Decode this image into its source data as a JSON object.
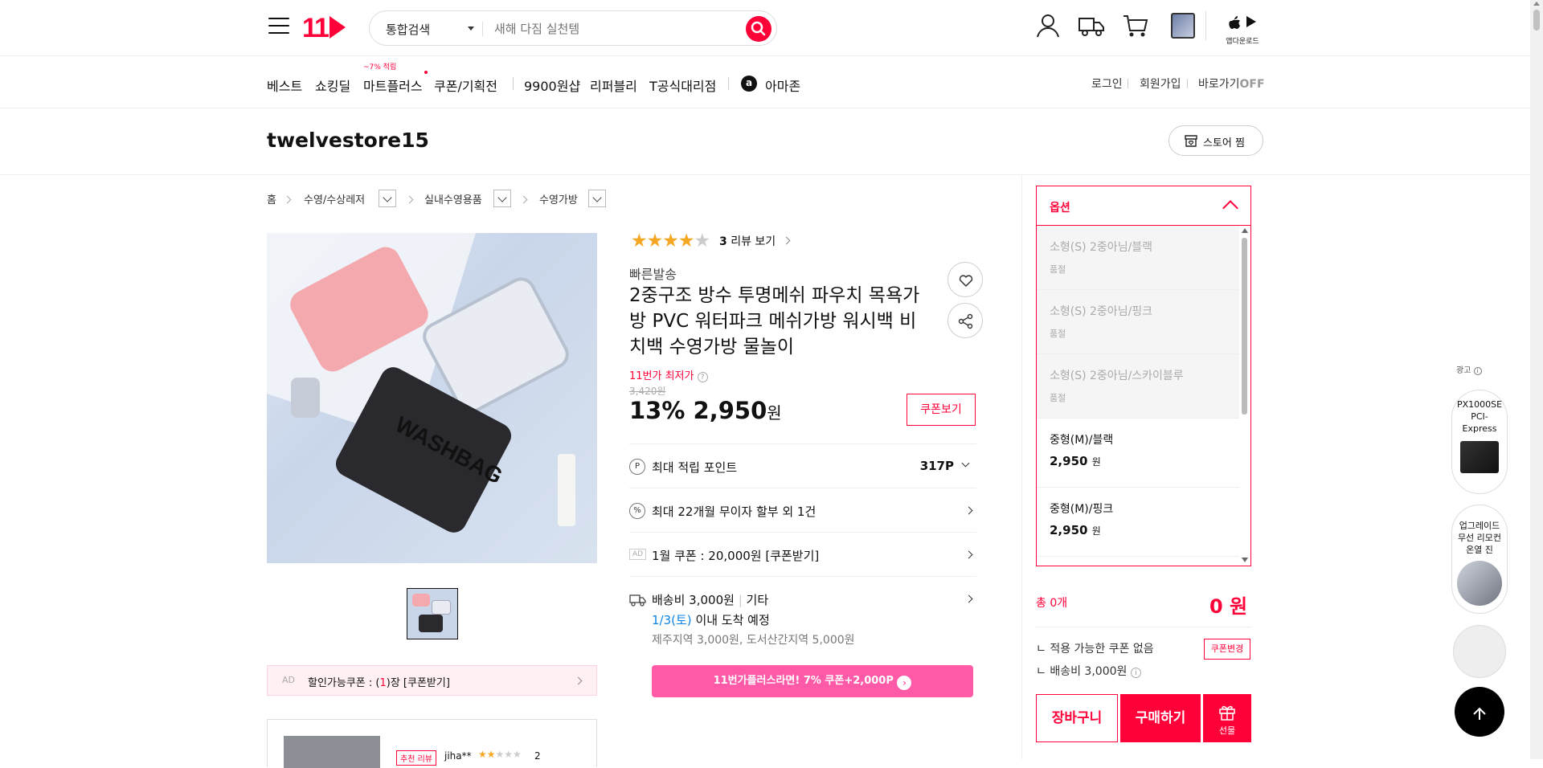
{
  "header": {
    "search_category": "통합검색",
    "search_placeholder": "새해 다짐 실천템",
    "app_download": "앱다운로드"
  },
  "gnb": {
    "items": [
      "베스트",
      "쇼킹딜",
      "마트플러스",
      "쿠폰/기획전",
      "9900원샵",
      "리퍼블리",
      "T공식대리점",
      "아마존"
    ],
    "mart_badge": "~7% 적립",
    "login": "로그인",
    "signup": "회원가입",
    "shortcut": "바로가기",
    "shortcut_state": "OFF"
  },
  "store": {
    "name": "twelvestore15",
    "fav_label": "스토어 찜"
  },
  "breadcrumb": [
    "홈",
    "수영/수상레저",
    "실내수영용품",
    "수영가방"
  ],
  "product": {
    "rating": 4,
    "review_count": "3",
    "review_label": "리뷰 보기",
    "fast": "빠른발송",
    "title": "2중구조 방수 투명메쉬 파우치 목욕가방 PVC 워터파크 메쉬가방 워시백 비치백 수영가방 물놀이",
    "lowest_label": "11번가 최저가",
    "original_price": "3,420원",
    "discount": "13%",
    "price": "2,950",
    "won": "원",
    "coupon_btn": "쿠폰보기",
    "image_text": "WASHBAG"
  },
  "rows": {
    "points_label": "최대 적립 포인트",
    "points_value": "317P",
    "installment": "최대 22개월 무이자 할부 외 1건",
    "ad_tag": "AD",
    "coupon_ad": "1월 쿠폰 : 20,000원 [쿠폰받기]",
    "shipping": "배송비 3,000원",
    "shipping_sep": "|",
    "shipping_type": "기타",
    "arrival_date": "1/3(토)",
    "arrival_text": "이내 도착 예정",
    "extra_fee": "제주지역 3,000원, 도서산간지역 5,000원",
    "plus_banner": "11번가플러스라면! 7% 쿠폰+2,000P"
  },
  "ad_coupon": {
    "tag": "AD",
    "pre": "할인가능쿠폰 : (",
    "count": "1",
    "post": ")장 [쿠폰받기]"
  },
  "review_preview": {
    "badge": "추천 리뷰",
    "user": "jiha**",
    "count": "2"
  },
  "options": {
    "header": "옵션",
    "sold_out_label": "품절",
    "items": [
      {
        "name": "소형(S) 2중아님/블랙",
        "status": "품절"
      },
      {
        "name": "소형(S) 2중아님/핑크",
        "status": "품절"
      },
      {
        "name": "소형(S) 2중아님/스카이블루",
        "status": "품절"
      },
      {
        "name": "중형(M)/블랙",
        "price": "2,950",
        "won": "원"
      },
      {
        "name": "중형(M)/핑크",
        "price": "2,950",
        "won": "원"
      }
    ]
  },
  "summary": {
    "total_label": "총 0개",
    "total_value": "0 원",
    "coupon_none": "적용 가능한 쿠폰 없음",
    "coupon_change": "쿠폰변경",
    "shipping": "배송비 3,000원",
    "cart": "장바구니",
    "buy": "구매하기",
    "gift": "선물"
  },
  "ads": {
    "label": "광고",
    "item1": "PX1000SE PCI-Express",
    "item2": "업그레이드 무선 리모컨 온열 진"
  },
  "colors": {
    "brand": "#ff0038",
    "plus": "#ff5aa8",
    "star": "#f5a623"
  }
}
